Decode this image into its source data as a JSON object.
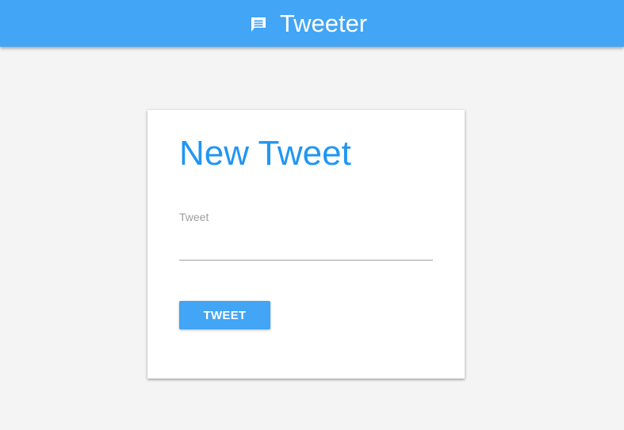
{
  "appbar": {
    "title": "Tweeter",
    "icon": "chat-bubble-icon",
    "color": "#42a5f5"
  },
  "card": {
    "title": "New Tweet",
    "title_color": "#2196f3",
    "field": {
      "label": "Tweet",
      "value": "",
      "placeholder": ""
    },
    "button": {
      "label": "TWEET",
      "color": "#42a5f5"
    }
  }
}
